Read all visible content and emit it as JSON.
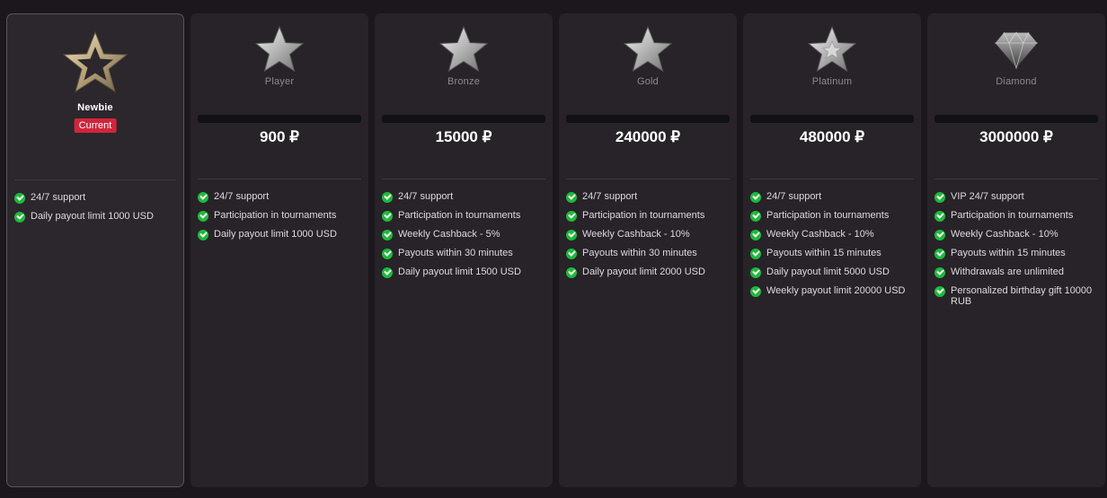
{
  "levels": [
    {
      "name": "Newbie",
      "badge": "Current",
      "icon": "gold-outline-star-icon",
      "features": [
        "24/7 support",
        "Daily payout limit 1000 USD"
      ]
    },
    {
      "name": "Player",
      "price": "900 ₽",
      "icon": "silver-star-icon",
      "features": [
        "24/7 support",
        "Participation in tournaments",
        "Daily payout limit 1000 USD"
      ]
    },
    {
      "name": "Bronze",
      "price": "15000 ₽",
      "icon": "silver-star-icon",
      "features": [
        "24/7 support",
        "Participation in tournaments",
        "Weekly Cashback - 5%",
        "Payouts within 30 minutes",
        "Daily payout limit 1500 USD"
      ]
    },
    {
      "name": "Gold",
      "price": "240000 ₽",
      "icon": "silver-star-icon",
      "features": [
        "24/7 support",
        "Participation in tournaments",
        "Weekly Cashback - 10%",
        "Payouts within 30 minutes",
        "Daily payout limit 2000 USD"
      ]
    },
    {
      "name": "Platinum",
      "price": "480000 ₽",
      "icon": "platinum-star-icon",
      "features": [
        "24/7 support",
        "Participation in tournaments",
        "Weekly Cashback - 10%",
        "Payouts within 15 minutes",
        "Daily payout limit 5000 USD",
        "Weekly payout limit 20000 USD"
      ]
    },
    {
      "name": "Diamond",
      "price": "3000000 ₽",
      "icon": "diamond-icon",
      "features": [
        "VIP 24/7 support",
        "Participation in tournaments",
        "Weekly Cashback - 10%",
        "Payouts within 15 minutes",
        "Withdrawals are unlimited",
        "Personalized birthday gift 10000 RUB"
      ]
    }
  ],
  "colors": {
    "background": "#1c171c",
    "card": "#272328",
    "badge": "#d0253b",
    "check": "#1fb93d"
  }
}
